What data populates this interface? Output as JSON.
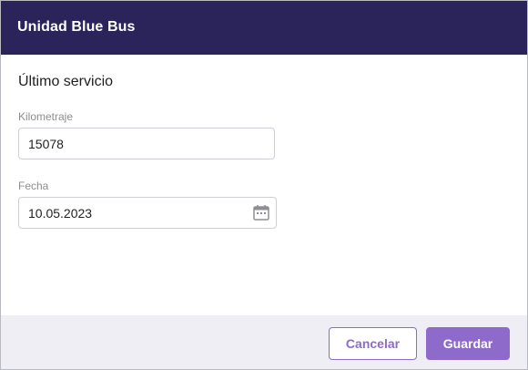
{
  "dialog": {
    "title": "Unidad Blue Bus",
    "section_title": "Último servicio"
  },
  "fields": {
    "kilometraje": {
      "label": "Kilometraje",
      "value": "15078"
    },
    "fecha": {
      "label": "Fecha",
      "value": "10.05.2023",
      "icon": "calendar-icon"
    }
  },
  "actions": {
    "cancel_label": "Cancelar",
    "save_label": "Guardar"
  },
  "colors": {
    "header_bg": "#2b245b",
    "accent": "#8e6acb",
    "footer_bg": "#efeef5"
  }
}
